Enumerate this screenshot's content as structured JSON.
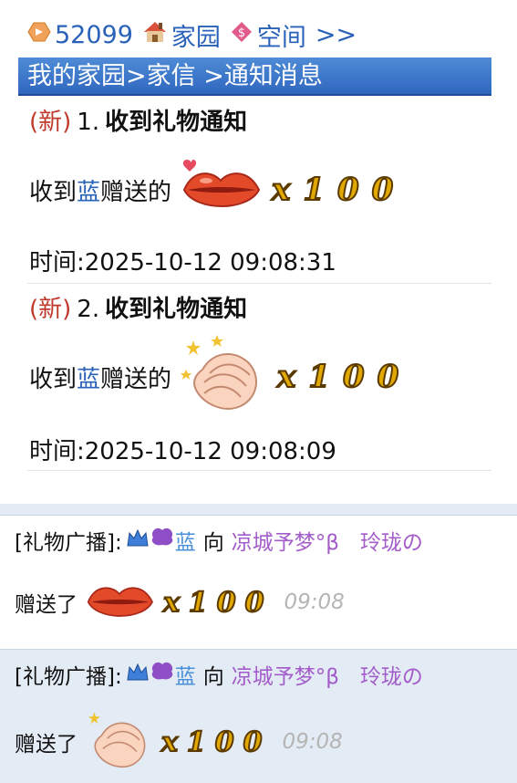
{
  "topnav": {
    "id": "52099",
    "home": "家园",
    "space": "空间",
    "more": ">>"
  },
  "breadcrumb": "我的家园>家信 >通知消息",
  "messages": [
    {
      "new": "(新)",
      "num": "1.",
      "title": "收到礼物通知",
      "recv_prefix": "收到",
      "sender": "蓝",
      "recv_suffix": "赠送的",
      "gift": "lips-icon",
      "qty": "x100",
      "time": "时间:2025-10-12 09:08:31"
    },
    {
      "new": "(新)",
      "num": "2.",
      "title": "收到礼物通知",
      "recv_prefix": "收到",
      "sender": "蓝",
      "recv_suffix": "赠送的",
      "gift": "clapping-hands-icon",
      "qty": "x100",
      "time": "时间:2025-10-12 09:08:09"
    }
  ],
  "broadcasts": [
    {
      "prefix": "[礼物广播]:",
      "sender": "蓝",
      "to": "向",
      "receiver": "凉城予梦°β　玲珑の",
      "sent": "赠送了",
      "gift": "lips-icon",
      "qty": "x100",
      "time": "09:08"
    },
    {
      "prefix": "[礼物广播]:",
      "sender": "蓝",
      "to": "向",
      "receiver": "凉城予梦°β　玲珑の",
      "sent": "赠送了",
      "gift": "clapping-hands-icon",
      "qty": "x100",
      "time": "09:08"
    }
  ],
  "colors": {
    "link": "#2a62b9",
    "new": "#c0392b",
    "purple": "#a35cc9",
    "band": "#e3ebf5"
  }
}
